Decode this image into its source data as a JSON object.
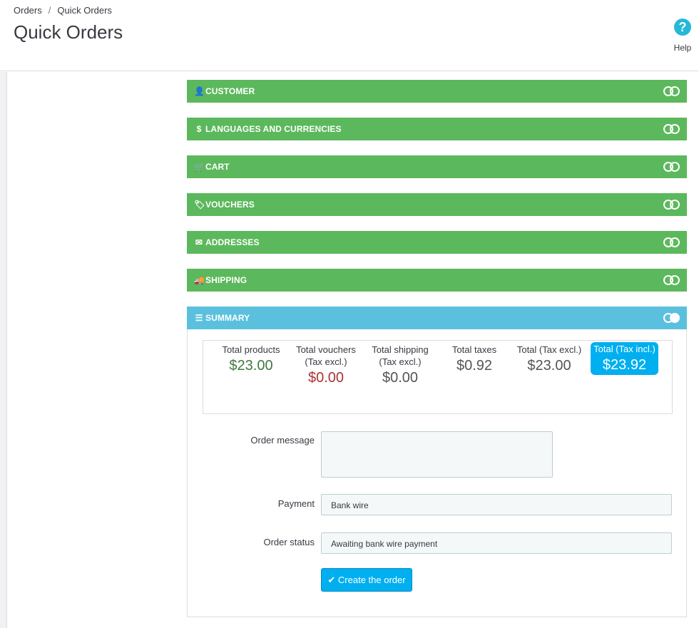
{
  "breadcrumb": {
    "parent": "Orders",
    "separator": "/",
    "current": "Quick Orders"
  },
  "page": {
    "title": "Quick Orders"
  },
  "help": {
    "icon": "?",
    "label": "Help"
  },
  "colors": {
    "section_collapsed": "#5cb85c",
    "section_active": "#5bc0de",
    "accent": "#00aff0"
  },
  "sections": [
    {
      "label": "CUSTOMER",
      "icon": "user-icon",
      "glyph": "👤"
    },
    {
      "label": "LANGUAGES AND CURRENCIES",
      "icon": "dollar-icon",
      "glyph": "$"
    },
    {
      "label": "CART",
      "icon": "cart-icon",
      "glyph": "🛒"
    },
    {
      "label": "VOUCHERS",
      "icon": "tag-icon",
      "glyph": "🏷"
    },
    {
      "label": "ADDRESSES",
      "icon": "envelope-icon",
      "glyph": "✉"
    },
    {
      "label": "SHIPPING",
      "icon": "truck-icon",
      "glyph": "🚚"
    },
    {
      "label": "SUMMARY",
      "icon": "list-icon",
      "glyph": "☰",
      "expanded": true
    }
  ],
  "summary": {
    "totals": [
      {
        "label": "Total products",
        "sub": "",
        "value": "$23.00"
      },
      {
        "label": "Total vouchers",
        "sub": "(Tax excl.)",
        "value": "$0.00"
      },
      {
        "label": "Total shipping",
        "sub": "(Tax excl.)",
        "value": "$0.00"
      },
      {
        "label": "Total taxes",
        "sub": "",
        "value": "$0.92"
      },
      {
        "label": "Total (Tax excl.)",
        "sub": "",
        "value": "$23.00"
      },
      {
        "label": "Total (Tax incl.)",
        "sub": "",
        "value": "$23.92"
      }
    ],
    "order_message_label": "Order message",
    "order_message_value": "",
    "payment_label": "Payment",
    "payment_value": "Bank wire",
    "order_status_label": "Order status",
    "order_status_value": "Awaiting bank wire payment",
    "create_button_label": "Create the order",
    "create_button_icon": "✔"
  }
}
